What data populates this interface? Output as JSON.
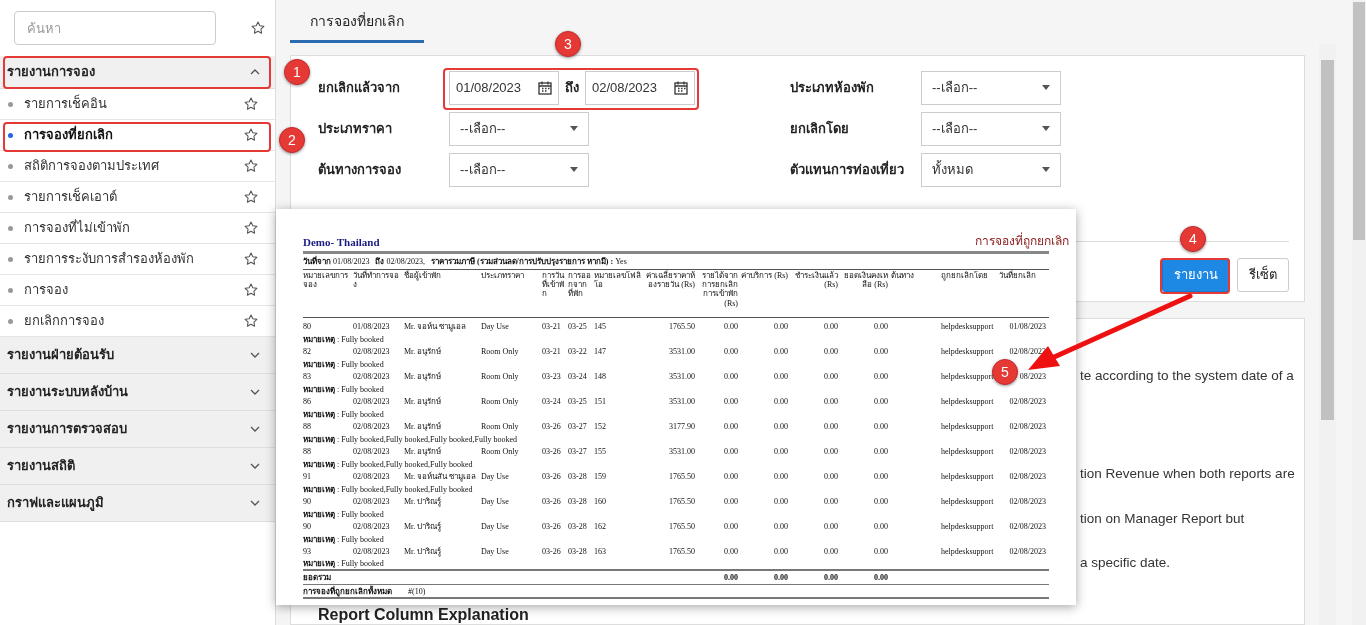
{
  "sidebar": {
    "search": {
      "placeholder": "ค้นหา"
    },
    "groups": [
      {
        "label": "รายงานการจอง",
        "expanded": true,
        "items": [
          {
            "label": "รายการเช็คอิน",
            "selected": false
          },
          {
            "label": "การจองที่ยกเลิก",
            "selected": true
          },
          {
            "label": "สถิติการจองตามประเทศ",
            "selected": false
          },
          {
            "label": "รายการเช็คเอาต์",
            "selected": false
          },
          {
            "label": "การจองที่ไม่เข้าพัก",
            "selected": false
          },
          {
            "label": "รายการระงับการสำรองห้องพัก",
            "selected": false
          },
          {
            "label": "การจอง",
            "selected": false
          },
          {
            "label": "ยกเลิกการจอง",
            "selected": false
          }
        ]
      },
      {
        "label": "รายงานฝ่ายต้อนรับ",
        "expanded": false
      },
      {
        "label": "รายงานระบบหลังบ้าน",
        "expanded": false
      },
      {
        "label": "รายงานการตรวจสอบ",
        "expanded": false
      },
      {
        "label": "รายงานสถิติ",
        "expanded": false
      },
      {
        "label": "กราฟและแผนภูมิ",
        "expanded": false
      }
    ]
  },
  "tabs": [
    {
      "label": "การจองที่ยกเลิก",
      "selected": true
    }
  ],
  "filters": {
    "cancelled_from": {
      "label": "ยกเลิกแล้วจาก",
      "from": "01/08/2023",
      "to_label": "ถึง",
      "to": "02/08/2023"
    },
    "left": [
      {
        "label": "ประเภทราคา",
        "value": "--เลือก--"
      },
      {
        "label": "ต้นทางการจอง",
        "value": "--เลือก--"
      }
    ],
    "right": [
      {
        "label": "ประเภทห้องพัก",
        "value": "--เลือก--"
      },
      {
        "label": "ยกเลิกโดย",
        "value": "--เลือก--"
      },
      {
        "label": "ตัวแทนการท่องเที่ยว",
        "value": "ทั้งหมด"
      }
    ]
  },
  "buttons": [
    {
      "label": "รายงาน",
      "kind": "primary"
    },
    {
      "label": "รีเซ็ต",
      "kind": "secondary"
    }
  ],
  "help_fragments": [
    "te according to the system date of a",
    "tion Revenue when both reports are",
    "tion on Manager Report but",
    "a specific date."
  ],
  "help_heading": "Report Column Explanation",
  "report": {
    "hotel": "Demo- Thailand",
    "title": "การจองที่ถูกยกเลิก",
    "info": "**วันที่จาก** 01/08/2023   **ถึง** 02/08/2023,   **ราคารวมภาษี (รวมส่วนลด/การปรับปรุงรายการ หากมี) :** Yes",
    "columns": [
      "หมายเลขการจอง",
      "วันที่ทำการจอง",
      "ชื่อผู้เข้าพัก",
      "ประเภทราคา",
      "การวันที่เข้าพัก",
      "การออกจากที่พัก",
      "หมายเลขโฟลิโอ",
      "ค่าเฉลี่ยราคาห้องรายวัน (Rs)",
      "รายได้จากการยกเลิกการเข้าพัก (Rs)",
      "ค่าบริการ (Rs)",
      "ชำระเงินแล้ว (Rs)",
      "ยอดเงินคงเหลือ (Rs)",
      "ต้นทาง",
      "ถูกยกเลิกโดย",
      "วันที่ยกเลิก"
    ],
    "rows": [
      {
        "booking_no": "80",
        "booking_date": "01/08/2023",
        "guest": "Mr. จอห์น ซามูเอล",
        "rate_type": "Day Use",
        "arrival": "03-21",
        "departure": "03-25",
        "folio": "145",
        "avg_rate": "1765.50",
        "cancel_revenue": "0.00",
        "service_charge": "0.00",
        "paid": "0.00",
        "balance": "0.00",
        "cancelled_by": "helpdesksupport",
        "cancel_date": "01/08/2023",
        "remark": "**หมายเหตุ** : Fully booked"
      },
      {
        "booking_no": "82",
        "booking_date": "02/08/2023",
        "guest": "Mr. อนุรักษ์",
        "rate_type": "Room Only",
        "arrival": "03-21",
        "departure": "03-22",
        "folio": "147",
        "avg_rate": "3531.00",
        "cancel_revenue": "0.00",
        "service_charge": "0.00",
        "paid": "0.00",
        "balance": "0.00",
        "cancelled_by": "helpdesksupport",
        "cancel_date": "02/08/2023",
        "remark": "**หมายเหตุ** : Fully booked"
      },
      {
        "booking_no": "83",
        "booking_date": "02/08/2023",
        "guest": "Mr. อนุรักษ์",
        "rate_type": "Room Only",
        "arrival": "03-23",
        "departure": "03-24",
        "folio": "148",
        "avg_rate": "3531.00",
        "cancel_revenue": "0.00",
        "service_charge": "0.00",
        "paid": "0.00",
        "balance": "0.00",
        "cancelled_by": "helpdesksupport",
        "cancel_date": "08/2023",
        "remark": "**หมายเหตุ** : Fully booked"
      },
      {
        "booking_no": "86",
        "booking_date": "02/08/2023",
        "guest": "Mr. อนุรักษ์",
        "rate_type": "Room Only",
        "arrival": "03-24",
        "departure": "03-25",
        "folio": "151",
        "avg_rate": "3531.00",
        "cancel_revenue": "0.00",
        "service_charge": "0.00",
        "paid": "0.00",
        "balance": "0.00",
        "cancelled_by": "helpdesksupport",
        "cancel_date": "02/08/2023",
        "remark": "**หมายเหตุ** : Fully booked"
      },
      {
        "booking_no": "88",
        "booking_date": "02/08/2023",
        "guest": "Mr. อนุรักษ์",
        "rate_type": "Room Only",
        "arrival": "03-26",
        "departure": "03-27",
        "folio": "152",
        "avg_rate": "3177.90",
        "cancel_revenue": "0.00",
        "service_charge": "0.00",
        "paid": "0.00",
        "balance": "0.00",
        "cancelled_by": "helpdesksupport",
        "cancel_date": "02/08/2023",
        "remark": "**หมายเหตุ** : Fully booked,Fully booked,Fully booked,Fully booked"
      },
      {
        "booking_no": "88",
        "booking_date": "02/08/2023",
        "guest": "Mr. อนุรักษ์",
        "rate_type": "Room Only",
        "arrival": "03-26",
        "departure": "03-27",
        "folio": "155",
        "avg_rate": "3531.00",
        "cancel_revenue": "0.00",
        "service_charge": "0.00",
        "paid": "0.00",
        "balance": "0.00",
        "cancelled_by": "helpdesksupport",
        "cancel_date": "02/08/2023",
        "remark": "**หมายเหตุ** : Fully booked,Fully booked,Fully booked"
      },
      {
        "booking_no": "91",
        "booking_date": "02/08/2023",
        "guest": "Mr. จอห์นสัน ซามูเอล",
        "rate_type": "Day Use",
        "arrival": "03-26",
        "departure": "03-28",
        "folio": "159",
        "avg_rate": "1765.50",
        "cancel_revenue": "0.00",
        "service_charge": "0.00",
        "paid": "0.00",
        "balance": "0.00",
        "cancelled_by": "helpdesksupport",
        "cancel_date": "02/08/2023",
        "remark": "**หมายเหตุ** : Fully booked,Fully booked,Fully booked"
      },
      {
        "booking_no": "90",
        "booking_date": "02/08/2023",
        "guest": "Mr. ปาริณรู์",
        "rate_type": "Day Use",
        "arrival": "03-26",
        "departure": "03-28",
        "folio": "160",
        "avg_rate": "1765.50",
        "cancel_revenue": "0.00",
        "service_charge": "0.00",
        "paid": "0.00",
        "balance": "0.00",
        "cancelled_by": "helpdesksupport",
        "cancel_date": "02/08/2023",
        "remark": "**หมายเหตุ** : Fully booked"
      },
      {
        "booking_no": "90",
        "booking_date": "02/08/2023",
        "guest": "Mr. ปาริณรู์",
        "rate_type": "Day Use",
        "arrival": "03-26",
        "departure": "03-28",
        "folio": "162",
        "avg_rate": "1765.50",
        "cancel_revenue": "0.00",
        "service_charge": "0.00",
        "paid": "0.00",
        "balance": "0.00",
        "cancelled_by": "helpdesksupport",
        "cancel_date": "02/08/2023",
        "remark": "**หมายเหตุ** : Fully booked"
      },
      {
        "booking_no": "93",
        "booking_date": "02/08/2023",
        "guest": "Mr. ปาริณรู์",
        "rate_type": "Day Use",
        "arrival": "03-26",
        "departure": "03-28",
        "folio": "163",
        "avg_rate": "1765.50",
        "cancel_revenue": "0.00",
        "service_charge": "0.00",
        "paid": "0.00",
        "balance": "0.00",
        "cancelled_by": "helpdesksupport",
        "cancel_date": "02/08/2023",
        "remark": "**หมายเหตุ** : Fully booked"
      }
    ],
    "total": {
      "label": "ยอดรวม",
      "cancel_revenue": "0.00",
      "service_charge": "0.00",
      "paid": "0.00",
      "balance": "0.00"
    },
    "count": {
      "label": "การจองที่ถูกยกเลิกทั้งหมด",
      "value": "#(10)"
    }
  },
  "annotations": [
    {
      "label": "1"
    },
    {
      "label": "2"
    },
    {
      "label": "3"
    },
    {
      "label": "4"
    },
    {
      "label": "5"
    }
  ]
}
